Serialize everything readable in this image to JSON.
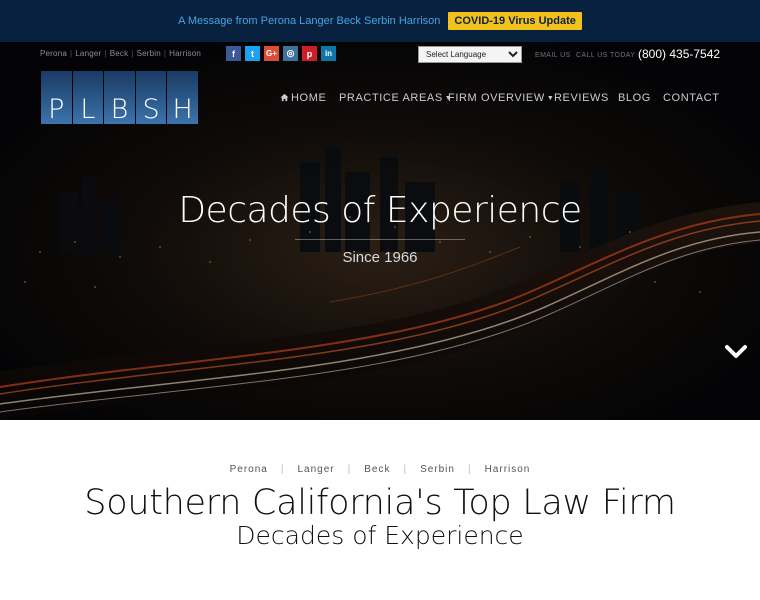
{
  "topbar": {
    "message": "A Message from Perona Langer Beck Serbin Harrison",
    "covid_button": "COVID-19 Virus Update"
  },
  "header": {
    "partner_names": [
      "Perona",
      "Langer",
      "Beck",
      "Serbin",
      "Harrison"
    ],
    "social": [
      {
        "name": "facebook-icon",
        "glyph": "f",
        "color": "#3b5998"
      },
      {
        "name": "twitter-icon",
        "glyph": "t",
        "color": "#1da1f2"
      },
      {
        "name": "google-plus-icon",
        "glyph": "G+",
        "color": "#dd4b39"
      },
      {
        "name": "instagram-icon",
        "glyph": "◎",
        "color": "#3f729b"
      },
      {
        "name": "pinterest-icon",
        "glyph": "p",
        "color": "#cb2027"
      },
      {
        "name": "linkedin-icon",
        "glyph": "in",
        "color": "#0e76a8"
      }
    ],
    "language_select": "Select Language",
    "email_label": "EMAIL US",
    "call_label": "CALL US TODAY",
    "phone": "(800) 435-7542",
    "logo_letters": [
      "P",
      "L",
      "B",
      "S",
      "H"
    ]
  },
  "nav": {
    "home": "HOME",
    "practice_areas": "PRACTICE AREAS",
    "firm_overview": "FIRM OVERVIEW",
    "reviews": "REVIEWS",
    "blog": "BLOG",
    "contact": "CONTACT"
  },
  "hero": {
    "title": "Decades of Experience",
    "subtitle": "Since 1966"
  },
  "intro": {
    "partners": [
      "Perona",
      "Langer",
      "Beck",
      "Serbin",
      "Harrison"
    ],
    "title": "Southern California's Top Law Firm",
    "subtitle": "Decades of Experience"
  },
  "colors": {
    "topbar_bg": "#07213f",
    "accent_yellow": "#f3c21a",
    "logo_blue": "#2d5c8f"
  }
}
